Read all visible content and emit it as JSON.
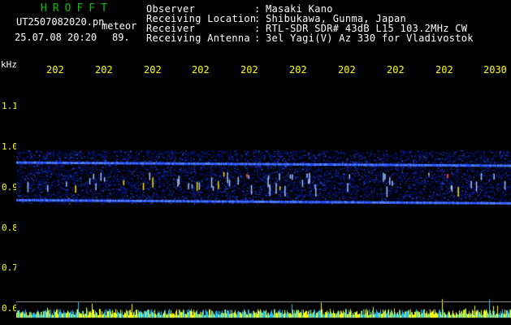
{
  "header": {
    "logo": "HROFFT",
    "filename": "UT2507082020.pn",
    "type": "meteor",
    "datetime": "25.07.08 20:20",
    "count": "89."
  },
  "info": [
    {
      "label": "Observer",
      "value": "Masaki Kano"
    },
    {
      "label": "Receiving Location",
      "value": "Shibukawa, Gunma, Japan"
    },
    {
      "label": "Receiver",
      "value": "RTL-SDR SDR# 43dB L15 103.2MHz CW"
    },
    {
      "label": "Receiving Antenna",
      "value": "3el Yagi(V) Az 330 for Vladivostok"
    }
  ],
  "axis": {
    "unit": "kHz",
    "y_ticks": [
      "1.1",
      "1.0",
      "0.9",
      "0.8",
      "0.7",
      "0.6"
    ],
    "x_ticks": [
      "202",
      "202",
      "202",
      "202",
      "202",
      "202",
      "202",
      "202",
      "202",
      "2030"
    ]
  },
  "colors": {
    "text": "#ffffff",
    "axis_labels": "#ffff00",
    "logo": "#00c000",
    "echo_bands": "#2040ff",
    "histogram": "#ffff00"
  },
  "spectrogram": {
    "band_upper_khz": 0.955,
    "band_lower_khz": 0.86,
    "noise_low_khz": 0.85,
    "noise_high_khz": 0.985
  }
}
